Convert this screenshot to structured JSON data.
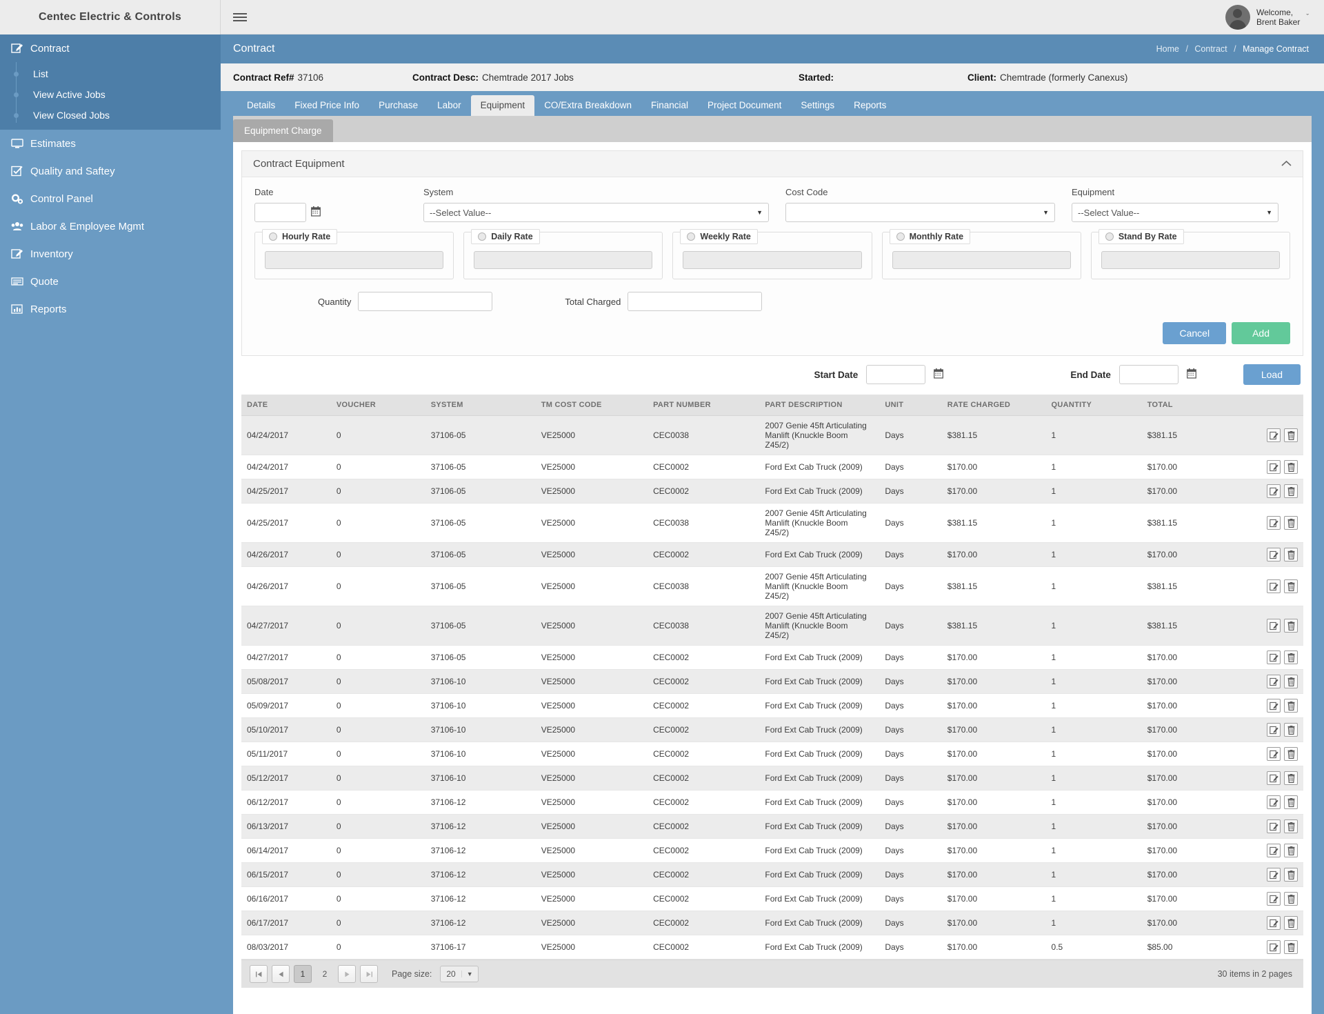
{
  "brand": {
    "name": "Centec Electric & Controls"
  },
  "topbar": {
    "menu_icon": "hamburger-icon",
    "welcome_line1": "Welcome,",
    "welcome_line2": "Brent Baker",
    "caret": "ˇ"
  },
  "sidebar": {
    "items": [
      {
        "label": "Contract",
        "icon": "edit-icon",
        "active": true
      },
      {
        "label": "Estimates",
        "icon": "monitor-icon"
      },
      {
        "label": "Quality and Saftey",
        "icon": "check-square-icon"
      },
      {
        "label": "Control Panel",
        "icon": "gears-icon"
      },
      {
        "label": "Labor & Employee Mgmt",
        "icon": "users-icon"
      },
      {
        "label": "Inventory",
        "icon": "edit-icon"
      },
      {
        "label": "Quote",
        "icon": "list-icon"
      },
      {
        "label": "Reports",
        "icon": "chart-bar-icon"
      }
    ],
    "subitems": [
      {
        "label": "List"
      },
      {
        "label": "View Active Jobs"
      },
      {
        "label": "View Closed Jobs"
      }
    ]
  },
  "pagehead": {
    "title": "Contract",
    "breadcrumb": [
      "Home",
      "Contract",
      "Manage Contract"
    ]
  },
  "contract_bar": {
    "ref_label": "Contract Ref#",
    "ref_value": "37106",
    "desc_label": "Contract Desc:",
    "desc_value": "Chemtrade 2017 Jobs",
    "started_label": "Started:",
    "started_value": "",
    "client_label": "Client:",
    "client_value": "Chemtrade (formerly Canexus)"
  },
  "tabs": [
    {
      "label": "Details"
    },
    {
      "label": "Fixed Price Info"
    },
    {
      "label": "Purchase"
    },
    {
      "label": "Labor"
    },
    {
      "label": "Equipment",
      "active": true
    },
    {
      "label": "CO/Extra Breakdown"
    },
    {
      "label": "Financial"
    },
    {
      "label": "Project Document"
    },
    {
      "label": "Settings"
    },
    {
      "label": "Reports"
    }
  ],
  "subtab": {
    "label": "Equipment Charge"
  },
  "panel": {
    "title": "Contract Equipment",
    "collapse_icon": "chevron-up-icon",
    "fields": {
      "date_label": "Date",
      "date_value": "",
      "system_label": "System",
      "system_value": "--Select Value--",
      "cost_code_label": "Cost Code",
      "cost_code_value": "",
      "equipment_label": "Equipment",
      "equipment_value": "--Select Value--"
    },
    "rates": [
      {
        "label": "Hourly Rate",
        "value": ""
      },
      {
        "label": "Daily Rate",
        "value": ""
      },
      {
        "label": "Weekly Rate",
        "value": ""
      },
      {
        "label": "Monthly Rate",
        "value": ""
      },
      {
        "label": "Stand By Rate",
        "value": ""
      }
    ],
    "quantity_label": "Quantity",
    "quantity_value": "",
    "total_charged_label": "Total Charged",
    "total_charged_value": "",
    "cancel_label": "Cancel",
    "add_label": "Add"
  },
  "filter": {
    "start_date_label": "Start Date",
    "start_date_value": "",
    "end_date_label": "End Date",
    "end_date_value": "",
    "load_label": "Load"
  },
  "table": {
    "columns": [
      "DATE",
      "VOUCHER",
      "SYSTEM",
      "TM COST CODE",
      "PART NUMBER",
      "PART DESCRIPTION",
      "UNIT",
      "RATE CHARGED",
      "QUANTITY",
      "TOTAL",
      ""
    ],
    "rows": [
      {
        "date": "04/24/2017",
        "voucher": "0",
        "system": "37106-05",
        "tm_cost_code": "VE25000",
        "part_number": "CEC0038",
        "part_description": "2007 Genie 45ft Articulating Manlift (Knuckle Boom Z45/2)",
        "unit": "Days",
        "rate_charged": "$381.15",
        "quantity": "1",
        "total": "$381.15"
      },
      {
        "date": "04/24/2017",
        "voucher": "0",
        "system": "37106-05",
        "tm_cost_code": "VE25000",
        "part_number": "CEC0002",
        "part_description": "Ford Ext Cab Truck (2009)",
        "unit": "Days",
        "rate_charged": "$170.00",
        "quantity": "1",
        "total": "$170.00"
      },
      {
        "date": "04/25/2017",
        "voucher": "0",
        "system": "37106-05",
        "tm_cost_code": "VE25000",
        "part_number": "CEC0002",
        "part_description": "Ford Ext Cab Truck (2009)",
        "unit": "Days",
        "rate_charged": "$170.00",
        "quantity": "1",
        "total": "$170.00"
      },
      {
        "date": "04/25/2017",
        "voucher": "0",
        "system": "37106-05",
        "tm_cost_code": "VE25000",
        "part_number": "CEC0038",
        "part_description": "2007 Genie 45ft Articulating Manlift (Knuckle Boom Z45/2)",
        "unit": "Days",
        "rate_charged": "$381.15",
        "quantity": "1",
        "total": "$381.15"
      },
      {
        "date": "04/26/2017",
        "voucher": "0",
        "system": "37106-05",
        "tm_cost_code": "VE25000",
        "part_number": "CEC0002",
        "part_description": "Ford Ext Cab Truck (2009)",
        "unit": "Days",
        "rate_charged": "$170.00",
        "quantity": "1",
        "total": "$170.00"
      },
      {
        "date": "04/26/2017",
        "voucher": "0",
        "system": "37106-05",
        "tm_cost_code": "VE25000",
        "part_number": "CEC0038",
        "part_description": "2007 Genie 45ft Articulating Manlift (Knuckle Boom Z45/2)",
        "unit": "Days",
        "rate_charged": "$381.15",
        "quantity": "1",
        "total": "$381.15"
      },
      {
        "date": "04/27/2017",
        "voucher": "0",
        "system": "37106-05",
        "tm_cost_code": "VE25000",
        "part_number": "CEC0038",
        "part_description": "2007 Genie 45ft Articulating Manlift (Knuckle Boom Z45/2)",
        "unit": "Days",
        "rate_charged": "$381.15",
        "quantity": "1",
        "total": "$381.15"
      },
      {
        "date": "04/27/2017",
        "voucher": "0",
        "system": "37106-05",
        "tm_cost_code": "VE25000",
        "part_number": "CEC0002",
        "part_description": "Ford Ext Cab Truck (2009)",
        "unit": "Days",
        "rate_charged": "$170.00",
        "quantity": "1",
        "total": "$170.00"
      },
      {
        "date": "05/08/2017",
        "voucher": "0",
        "system": "37106-10",
        "tm_cost_code": "VE25000",
        "part_number": "CEC0002",
        "part_description": "Ford Ext Cab Truck (2009)",
        "unit": "Days",
        "rate_charged": "$170.00",
        "quantity": "1",
        "total": "$170.00"
      },
      {
        "date": "05/09/2017",
        "voucher": "0",
        "system": "37106-10",
        "tm_cost_code": "VE25000",
        "part_number": "CEC0002",
        "part_description": "Ford Ext Cab Truck (2009)",
        "unit": "Days",
        "rate_charged": "$170.00",
        "quantity": "1",
        "total": "$170.00"
      },
      {
        "date": "05/10/2017",
        "voucher": "0",
        "system": "37106-10",
        "tm_cost_code": "VE25000",
        "part_number": "CEC0002",
        "part_description": "Ford Ext Cab Truck (2009)",
        "unit": "Days",
        "rate_charged": "$170.00",
        "quantity": "1",
        "total": "$170.00"
      },
      {
        "date": "05/11/2017",
        "voucher": "0",
        "system": "37106-10",
        "tm_cost_code": "VE25000",
        "part_number": "CEC0002",
        "part_description": "Ford Ext Cab Truck (2009)",
        "unit": "Days",
        "rate_charged": "$170.00",
        "quantity": "1",
        "total": "$170.00"
      },
      {
        "date": "05/12/2017",
        "voucher": "0",
        "system": "37106-10",
        "tm_cost_code": "VE25000",
        "part_number": "CEC0002",
        "part_description": "Ford Ext Cab Truck (2009)",
        "unit": "Days",
        "rate_charged": "$170.00",
        "quantity": "1",
        "total": "$170.00"
      },
      {
        "date": "06/12/2017",
        "voucher": "0",
        "system": "37106-12",
        "tm_cost_code": "VE25000",
        "part_number": "CEC0002",
        "part_description": "Ford Ext Cab Truck (2009)",
        "unit": "Days",
        "rate_charged": "$170.00",
        "quantity": "1",
        "total": "$170.00"
      },
      {
        "date": "06/13/2017",
        "voucher": "0",
        "system": "37106-12",
        "tm_cost_code": "VE25000",
        "part_number": "CEC0002",
        "part_description": "Ford Ext Cab Truck (2009)",
        "unit": "Days",
        "rate_charged": "$170.00",
        "quantity": "1",
        "total": "$170.00"
      },
      {
        "date": "06/14/2017",
        "voucher": "0",
        "system": "37106-12",
        "tm_cost_code": "VE25000",
        "part_number": "CEC0002",
        "part_description": "Ford Ext Cab Truck (2009)",
        "unit": "Days",
        "rate_charged": "$170.00",
        "quantity": "1",
        "total": "$170.00"
      },
      {
        "date": "06/15/2017",
        "voucher": "0",
        "system": "37106-12",
        "tm_cost_code": "VE25000",
        "part_number": "CEC0002",
        "part_description": "Ford Ext Cab Truck (2009)",
        "unit": "Days",
        "rate_charged": "$170.00",
        "quantity": "1",
        "total": "$170.00"
      },
      {
        "date": "06/16/2017",
        "voucher": "0",
        "system": "37106-12",
        "tm_cost_code": "VE25000",
        "part_number": "CEC0002",
        "part_description": "Ford Ext Cab Truck (2009)",
        "unit": "Days",
        "rate_charged": "$170.00",
        "quantity": "1",
        "total": "$170.00"
      },
      {
        "date": "06/17/2017",
        "voucher": "0",
        "system": "37106-12",
        "tm_cost_code": "VE25000",
        "part_number": "CEC0002",
        "part_description": "Ford Ext Cab Truck (2009)",
        "unit": "Days",
        "rate_charged": "$170.00",
        "quantity": "1",
        "total": "$170.00"
      },
      {
        "date": "08/03/2017",
        "voucher": "0",
        "system": "37106-17",
        "tm_cost_code": "VE25000",
        "part_number": "CEC0002",
        "part_description": "Ford Ext Cab Truck (2009)",
        "unit": "Days",
        "rate_charged": "$170.00",
        "quantity": "0.5",
        "total": "$85.00"
      }
    ],
    "row_actions": {
      "edit_icon": "edit-icon",
      "delete_icon": "trash-icon"
    }
  },
  "pager": {
    "first": "◀|",
    "prev": "◀",
    "next": "▶",
    "last": "|▶",
    "pages": [
      "1",
      "2"
    ],
    "current_page": "1",
    "page_size_label": "Page size:",
    "page_size_value": "20",
    "summary": "30 items in 2 pages"
  },
  "colors": {
    "sidebar": "#6b9bc3",
    "sidebar_active": "#4d7ea8",
    "pagehead": "#5b8cb5",
    "primary_button": "#6aa0d0",
    "add_button": "#62c99a"
  }
}
